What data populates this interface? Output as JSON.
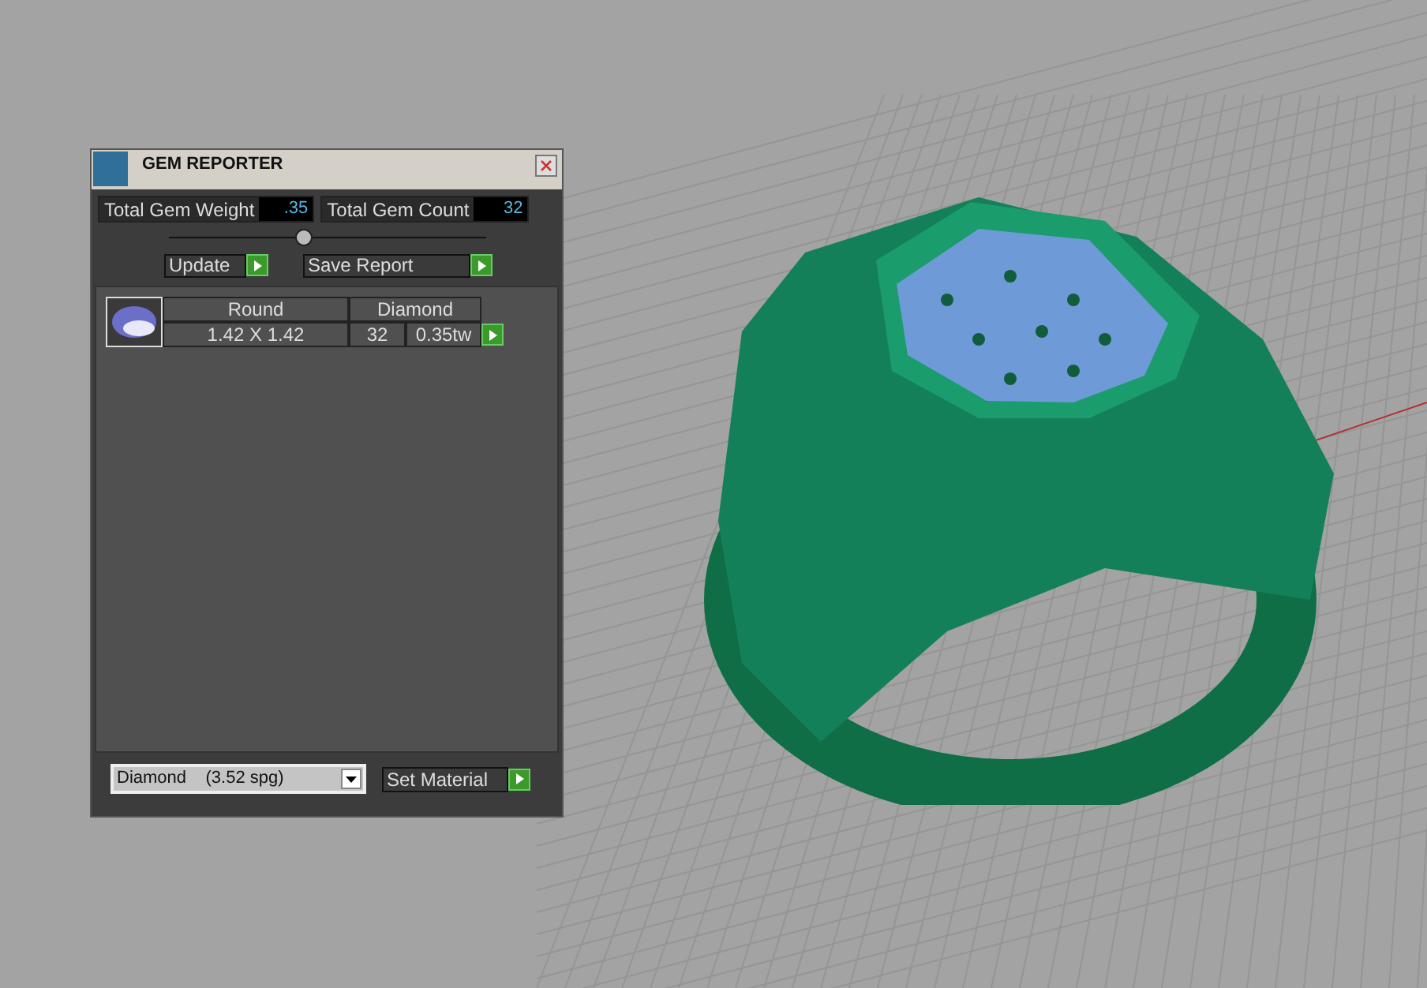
{
  "window": {
    "title": "GEM REPORTER"
  },
  "totals": [
    {
      "label": "Total Gem Weight",
      "value": ".35"
    },
    {
      "label": "Total Gem Count",
      "value": "32"
    }
  ],
  "buttons": [
    "Update",
    "Save Report"
  ],
  "gems": [
    {
      "shape": "Round",
      "material": "Diamond",
      "size": "1.42 X 1.42",
      "count": "32",
      "weight": "0.35tw"
    }
  ],
  "material_select": {
    "value": "Diamond    (3.52 spg)"
  },
  "set_button": "Set Material"
}
